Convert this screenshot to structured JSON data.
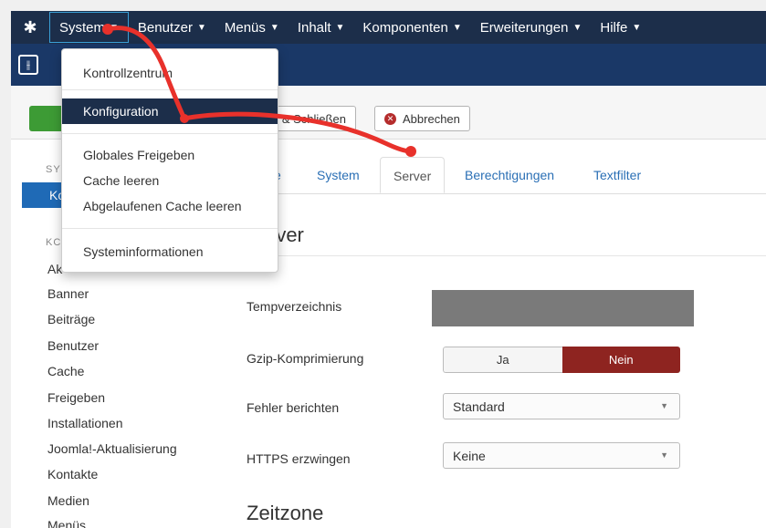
{
  "topnav": {
    "logo_icon": "joomla-logo-icon",
    "items": [
      {
        "label": "System",
        "active": true
      },
      {
        "label": "Benutzer"
      },
      {
        "label": "Menüs"
      },
      {
        "label": "Inhalt"
      },
      {
        "label": "Komponenten"
      },
      {
        "label": "Erweiterungen"
      },
      {
        "label": "Hilfe"
      }
    ]
  },
  "subheader": {
    "icon": "settings-sliders-icon"
  },
  "system_menu": {
    "items": [
      {
        "label": "Kontrollzentrum"
      },
      {
        "label": "Konfiguration",
        "active": true
      },
      {
        "label": "Globales Freigeben"
      },
      {
        "label": "Cache leeren"
      },
      {
        "label": "Abgelaufenen Cache leeren"
      },
      {
        "label": "Systeminformationen"
      }
    ]
  },
  "toolbar": {
    "save_close_partial": "n & Schließen",
    "cancel_label": "Abbrechen"
  },
  "sidebar": {
    "section1_partial": "SY",
    "active_partial": "Ko",
    "section2_partial": "KC",
    "partial_item": "Ak",
    "items": [
      "Banner",
      "Beiträge",
      "Benutzer",
      "Cache",
      "Freigeben",
      "Installationen",
      "Joomla!-Aktualisierung",
      "Kontakte",
      "Medien",
      "Menüs"
    ]
  },
  "tabs": {
    "partial": "e",
    "items": [
      "System",
      "Server",
      "Berechtigungen",
      "Textfilter"
    ],
    "active": "Server"
  },
  "server": {
    "heading_partial": "rver",
    "fields": {
      "temp_label": "Tempverzeichnis",
      "gzip_label": "Gzip-Komprimierung",
      "gzip_yes": "Ja",
      "gzip_no": "Nein",
      "gzip_value": "Nein",
      "error_label": "Fehler berichten",
      "error_value": "Standard",
      "https_label": "HTTPS erzwingen",
      "https_value": "Keine"
    }
  },
  "timezone": {
    "heading": "Zeitzone"
  },
  "colors": {
    "nav_bg": "#1c2e4a",
    "subheader_bg": "#1a3867",
    "active_blue": "#1f6ab6",
    "toggle_no": "#8e2420",
    "annotation_red": "#e8312b"
  }
}
